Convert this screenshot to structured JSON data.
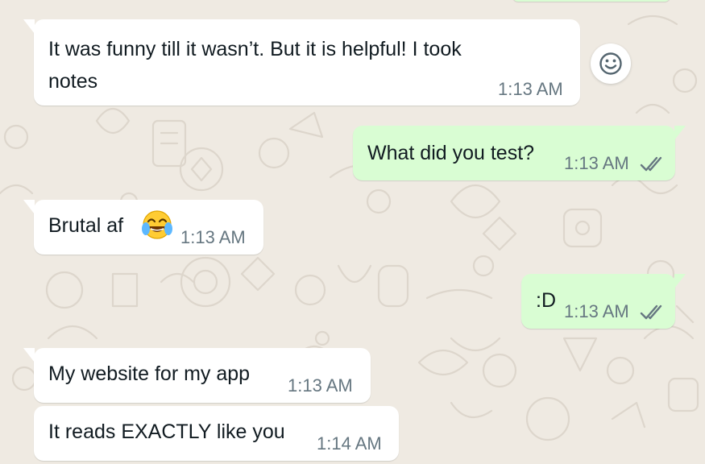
{
  "messages": [
    {
      "direction": "incoming",
      "text_line1": "It was funny till it wasn’t. But it is helpful! I took",
      "text_line2": "notes",
      "time": "1:13 AM"
    },
    {
      "direction": "outgoing",
      "text": "What did you test?",
      "time": "1:13 AM",
      "status": "read"
    },
    {
      "direction": "incoming",
      "text": "Brutal af",
      "emoji": "face-with-tears-of-joy",
      "time": "1:13 AM"
    },
    {
      "direction": "outgoing",
      "text": ":D",
      "time": "1:13 AM",
      "status": "read"
    },
    {
      "direction": "incoming",
      "text": "My website for my app",
      "time": "1:13 AM"
    },
    {
      "direction": "incoming",
      "text": "It reads EXACTLY like you",
      "time": "1:14 AM"
    }
  ],
  "icons": {
    "react": "smiley-icon",
    "read_receipt": "double-check-icon"
  },
  "colors": {
    "background": "#efeae2",
    "incoming_bubble": "#ffffff",
    "outgoing_bubble": "#d9fdd3",
    "timestamp": "#667781",
    "read_ticks": "#667781",
    "text": "#111b21"
  }
}
